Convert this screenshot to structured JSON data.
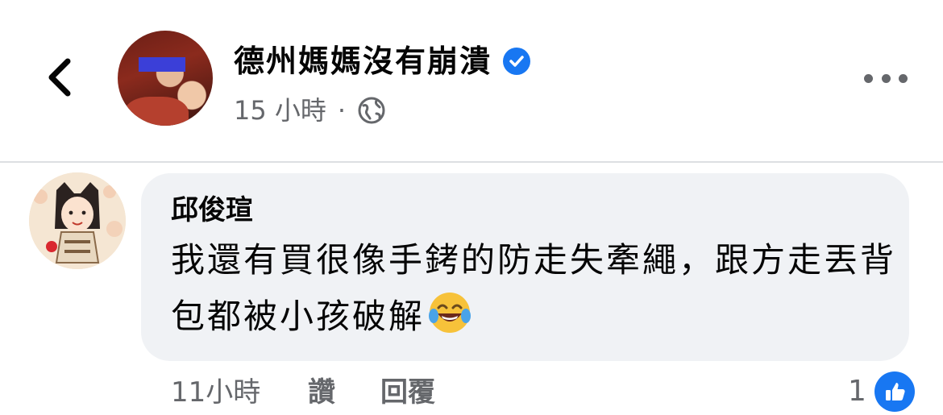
{
  "header": {
    "page_name": "德州媽媽沒有崩潰",
    "post_time": "15 小時",
    "separator": "·",
    "privacy_icon": "globe-icon",
    "back_icon": "chevron-left-icon",
    "more_icon": "more-horizontal-icon"
  },
  "comment": {
    "author": "邱俊瑄",
    "text": "我還有買很像手銬的防走失牽繩，跟方走丟背包都被小孩破解",
    "emoji": "face-with-tears-of-joy",
    "time": "11小時",
    "like_label": "讚",
    "reply_label": "回覆",
    "reaction_count": "1",
    "reaction_icon": "like-icon"
  },
  "colors": {
    "accent": "#1877f2",
    "secondary_text": "#65676b",
    "bubble": "#f0f2f5",
    "divider": "#dddfe2"
  }
}
